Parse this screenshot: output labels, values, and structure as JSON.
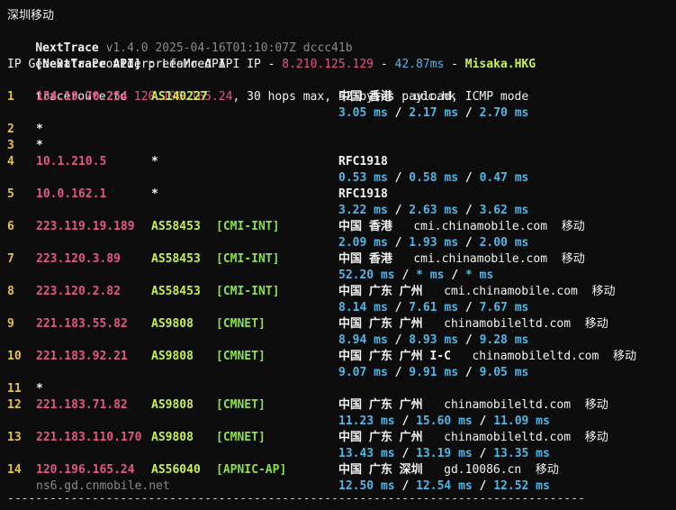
{
  "separator": "----------------------------------------------------------------------------------",
  "header": {
    "location": "深圳移动",
    "app_name": "NextTrace",
    "version_line": "v1.4.0 2025-04-16T01:10:07Z dccc41b",
    "api_bracket": "[NextTrace API]",
    "api_text": " preferred API IP - ",
    "api_ip": "8.210.125.129",
    "dash1": " - ",
    "api_latency": "42.87ms",
    "dash2": " - ",
    "api_node": "Misaka.HKG",
    "geo_provider": "IP Geo Data Provider: LeoMoeAPI",
    "traceroute_prefix": "traceroute to ",
    "target_ip": "120.196.165.24",
    "traceroute_suffix": ", 30 hops max, 52 bytes payload, ICMP mode"
  },
  "hops": [
    {
      "num": "1",
      "ip": "154.19.70.254",
      "as": "AS140227",
      "tag": "",
      "geo": "中国 香港",
      "host": "udc.hk",
      "isp": "",
      "rtt": [
        "3.05 ms",
        "2.17 ms",
        "2.70 ms"
      ],
      "ptr": ""
    },
    {
      "num": "2",
      "star": "*"
    },
    {
      "num": "3",
      "star": "*"
    },
    {
      "num": "4",
      "ip": "10.1.210.5",
      "as": "*",
      "tag": "",
      "geo": "RFC1918",
      "host": "",
      "isp": "",
      "rtt": [
        "0.53 ms",
        "0.58 ms",
        "0.47 ms"
      ],
      "ptr": ""
    },
    {
      "num": "5",
      "ip": "10.0.162.1",
      "as": "*",
      "tag": "",
      "geo": "RFC1918",
      "host": "",
      "isp": "",
      "rtt": [
        "3.22 ms",
        "2.63 ms",
        "3.62 ms"
      ],
      "ptr": ""
    },
    {
      "num": "6",
      "ip": "223.119.19.189",
      "as": "AS58453",
      "tag": "[CMI-INT]",
      "geo": "中国 香港",
      "host": "cmi.chinamobile.com",
      "isp": "移动",
      "rtt": [
        "2.09 ms",
        "1.93 ms",
        "2.00 ms"
      ],
      "ptr": ""
    },
    {
      "num": "7",
      "ip": "223.120.3.89",
      "as": "AS58453",
      "tag": "[CMI-INT]",
      "geo": "中国 香港",
      "host": "cmi.chinamobile.com",
      "isp": "移动",
      "rtt": [
        "52.20 ms",
        "* ms",
        "* ms"
      ],
      "ptr": ""
    },
    {
      "num": "8",
      "ip": "223.120.2.82",
      "as": "AS58453",
      "tag": "[CMI-INT]",
      "geo": "中国 广东 广州",
      "host": "cmi.chinamobile.com",
      "isp": "移动",
      "rtt": [
        "8.14 ms",
        "7.61 ms",
        "7.67 ms"
      ],
      "ptr": ""
    },
    {
      "num": "9",
      "ip": "221.183.55.82",
      "as": "AS9808",
      "tag": "[CMNET]",
      "geo": "中国 广东 广州",
      "host": "chinamobileltd.com",
      "isp": "移动",
      "rtt": [
        "8.94 ms",
        "8.93 ms",
        "9.28 ms"
      ],
      "ptr": ""
    },
    {
      "num": "10",
      "ip": "221.183.92.21",
      "as": "AS9808",
      "tag": "[CMNET]",
      "geo": "中国 广东 广州 I-C",
      "host": "chinamobileltd.com",
      "isp": "移动",
      "rtt": [
        "9.07 ms",
        "9.91 ms",
        "9.05 ms"
      ],
      "ptr": ""
    },
    {
      "num": "11",
      "star": "*"
    },
    {
      "num": "12",
      "ip": "221.183.71.82",
      "as": "AS9808",
      "tag": "[CMNET]",
      "geo": "中国 广东 广州",
      "host": "chinamobileltd.com",
      "isp": "移动",
      "rtt": [
        "11.23 ms",
        "15.60 ms",
        "11.09 ms"
      ],
      "ptr": ""
    },
    {
      "num": "13",
      "ip": "221.183.110.170",
      "as": "AS9808",
      "tag": "[CMNET]",
      "geo": "中国 广东 广州",
      "host": "chinamobileltd.com",
      "isp": "移动",
      "rtt": [
        "13.43 ms",
        "13.19 ms",
        "13.35 ms"
      ],
      "ptr": ""
    },
    {
      "num": "14",
      "ip": "120.196.165.24",
      "as": "AS56040",
      "tag": "[APNIC-AP]",
      "geo": "中国 广东 深圳",
      "host": "gd.10086.cn",
      "isp": "移动",
      "rtt": [
        "12.50 ms",
        "12.54 ms",
        "12.52 ms"
      ],
      "ptr": "ns6.gd.cnmobile.net"
    }
  ],
  "rtt_separator": " / ",
  "colors": {
    "background": "#0c0c0c",
    "ip": "#e5568a",
    "asn": "#c7f24a",
    "tag": "#8ce04a",
    "rtt": "#4fb7e8",
    "hop_number": "#e6c33c"
  }
}
